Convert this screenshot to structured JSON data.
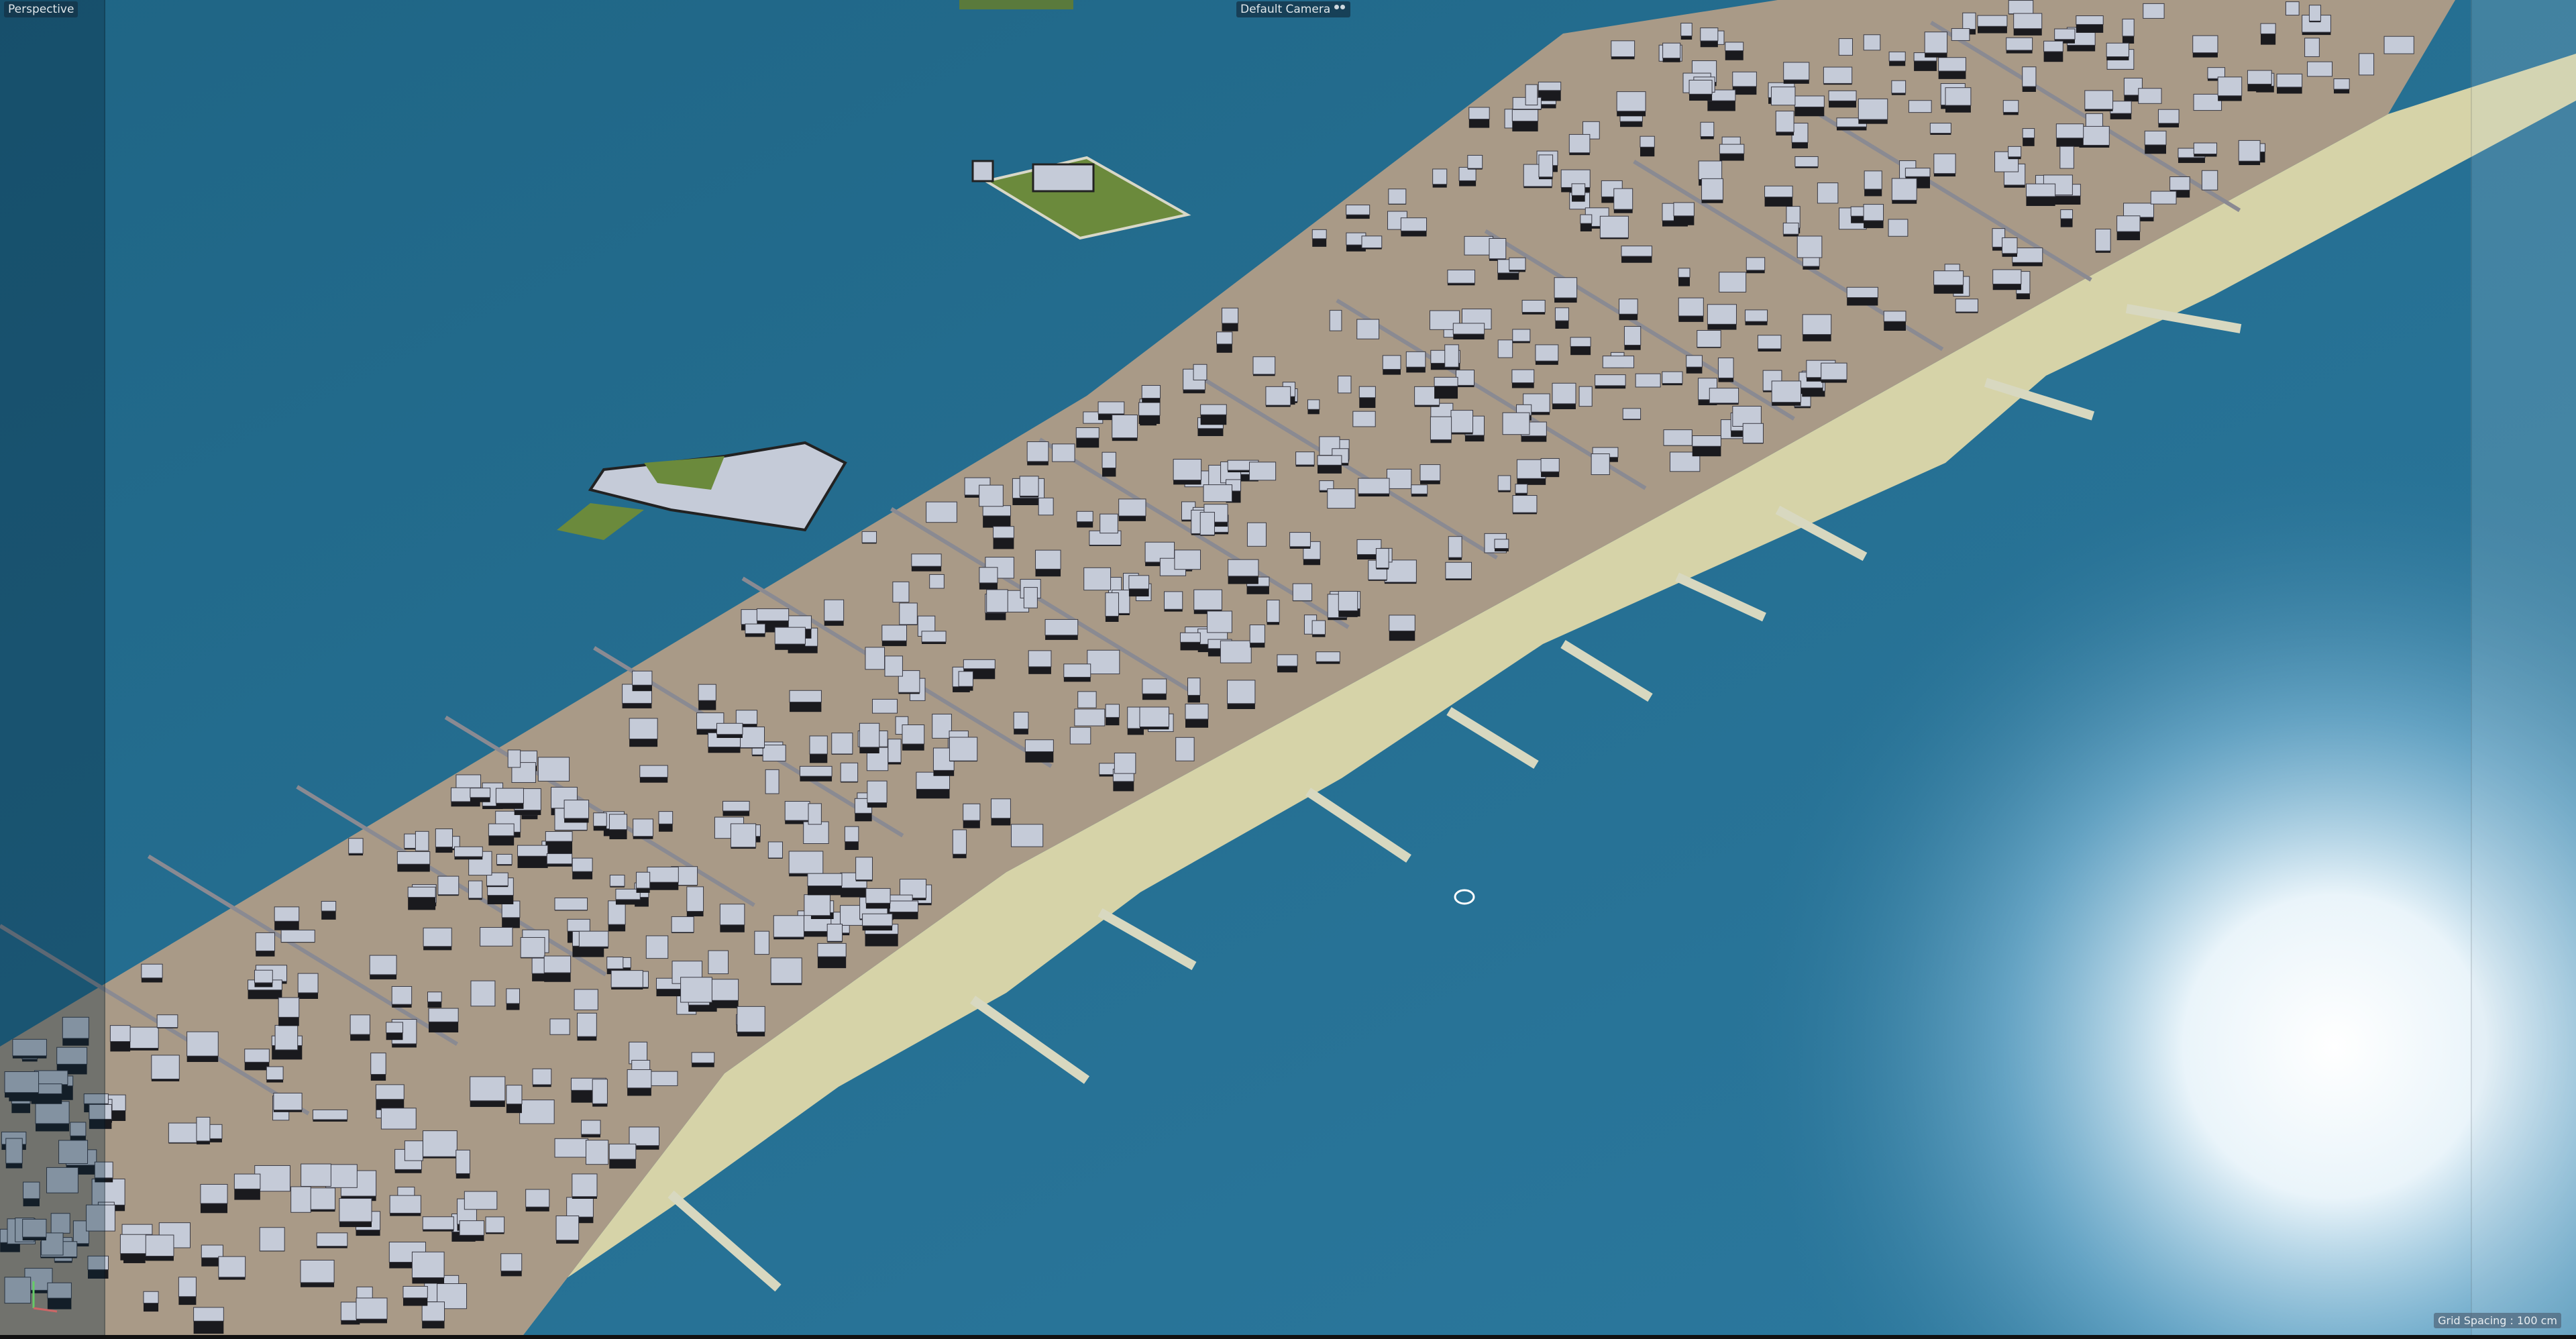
{
  "viewport": {
    "view_mode": "Perspective",
    "camera": "Default Camera",
    "grid_spacing": "Grid Spacing : 100 cm"
  },
  "icons": {
    "camera": "camera-icon",
    "axis": "axis-gizmo-icon"
  },
  "colors": {
    "water": "#2a7194",
    "land": "#a99a87",
    "beach": "#d6d3a8",
    "building": "#c5cbd8",
    "park": "#6b8a3c"
  }
}
